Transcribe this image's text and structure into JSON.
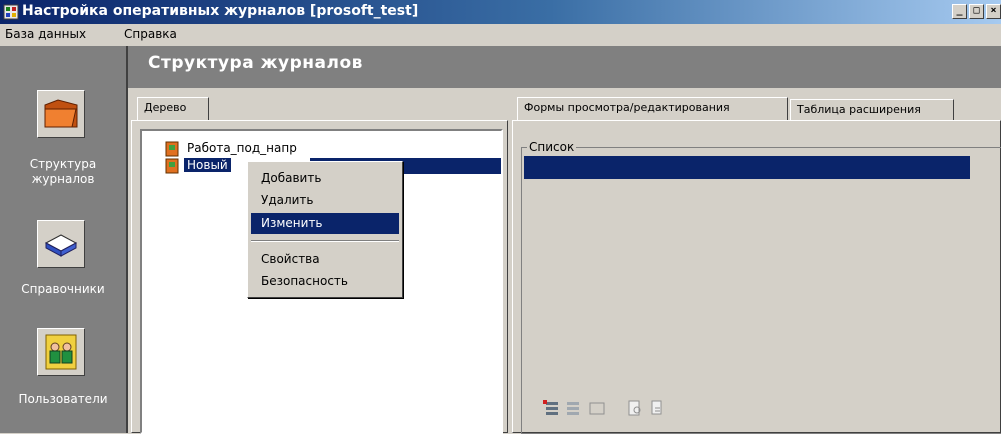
{
  "window": {
    "title": "Настройка оперативных журналов [prosoft_test]",
    "buttons": {
      "minimize": "_",
      "maximize": "□",
      "close": "×"
    }
  },
  "menu": [
    "База данных",
    "Справка"
  ],
  "sidebar": {
    "items": [
      {
        "label_line1": "Структура",
        "label_line2": "журналов",
        "icon": "folder-icon"
      },
      {
        "label_line1": "Справочники",
        "label_line2": "",
        "icon": "book-icon"
      },
      {
        "label_line1": "Пользователи",
        "label_line2": "",
        "icon": "users-icon"
      }
    ]
  },
  "header": {
    "title": "Структура журналов"
  },
  "left_panel": {
    "tab": "Дерево",
    "tree": [
      {
        "label": "Работа_под_напр",
        "selected": false
      },
      {
        "label": "Новый",
        "selected": true
      }
    ]
  },
  "context_menu": {
    "items_top": [
      "Добавить",
      "Удалить",
      "Изменить"
    ],
    "items_bottom": [
      "Свойства",
      "Безопасность"
    ],
    "highlighted": "Изменить"
  },
  "right_panel": {
    "tabs": [
      "Формы просмотра/редактирования",
      "Таблица расширения"
    ],
    "active_tab": "Формы просмотра/редактирования",
    "group_label": "Список",
    "toolbar_icons": [
      "add-form-icon",
      "delete-form-icon",
      "blank-form-icon",
      "preview-icon",
      "copy-icon"
    ]
  },
  "colors": {
    "selection": "#0a246a",
    "face": "#d4d0c8",
    "shadow": "#808080"
  }
}
